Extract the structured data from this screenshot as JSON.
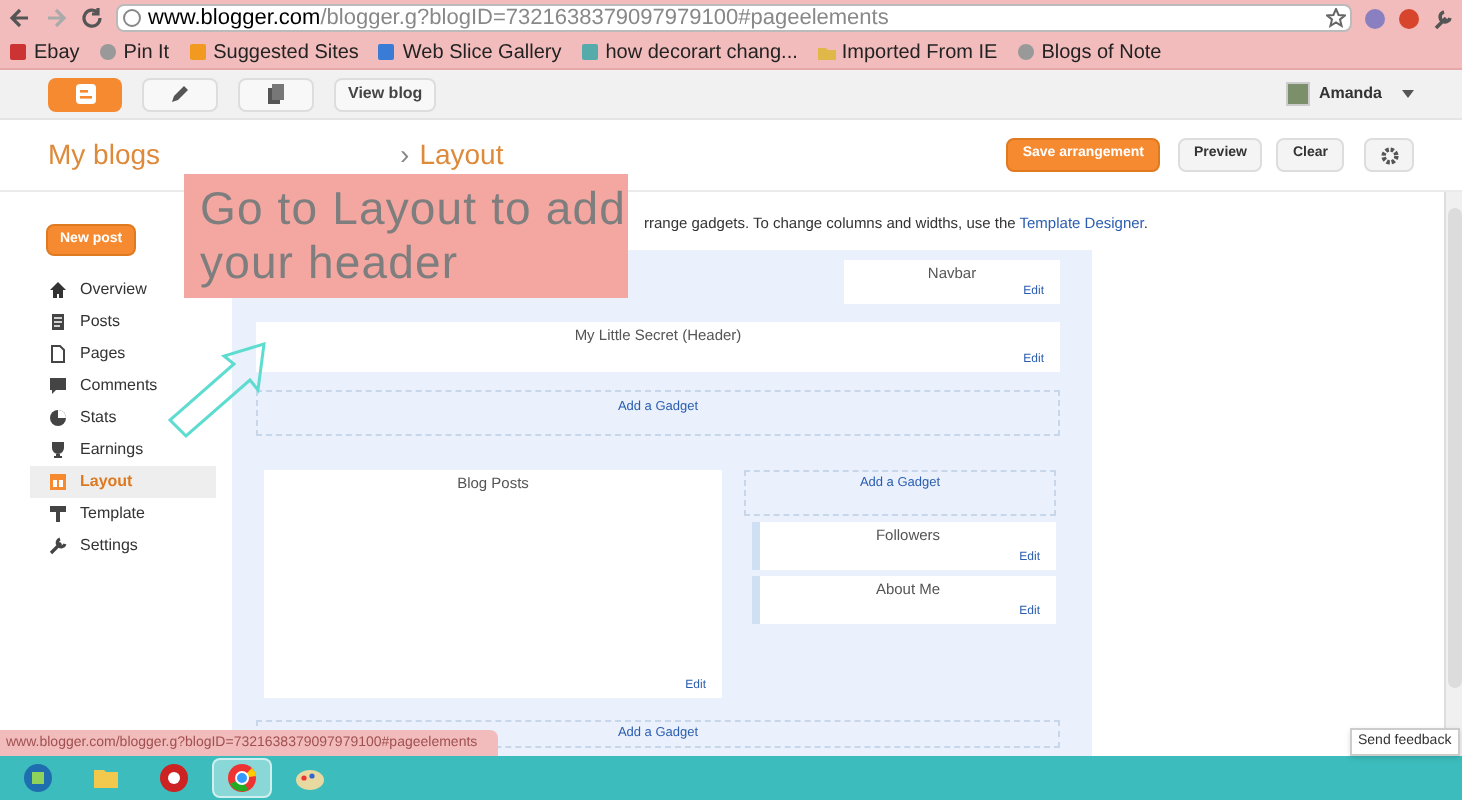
{
  "browser": {
    "url_host": "www.blogger.com",
    "url_path": "/blogger.g?blogID=7321638379097979100#pageelements",
    "bookmarks": [
      "Ebay",
      "Pin It",
      "Suggested Sites",
      "Web Slice Gallery",
      "how decorart chang...",
      "Imported From IE",
      "Blogs of Note"
    ]
  },
  "topbar": {
    "view_blog": "View blog",
    "user": "Amanda"
  },
  "header": {
    "title": "My blogs",
    "breadcrumb_sep": "›",
    "breadcrumb": "Layout",
    "actions": [
      "Save arrangement",
      "Preview",
      "Clear"
    ]
  },
  "sidebar": {
    "new_post": "New post",
    "items": [
      {
        "label": "Overview",
        "selected": false
      },
      {
        "label": "Posts",
        "selected": false
      },
      {
        "label": "Pages",
        "selected": false
      },
      {
        "label": "Comments",
        "selected": false
      },
      {
        "label": "Stats",
        "selected": false
      },
      {
        "label": "Earnings",
        "selected": false
      },
      {
        "label": "Layout",
        "selected": true
      },
      {
        "label": "Template",
        "selected": false
      },
      {
        "label": "Settings",
        "selected": false
      }
    ]
  },
  "description": {
    "text": "rrange gadgets. To change columns and widths, use the",
    "link": "Template Designer",
    "end": "."
  },
  "layout": {
    "navbar": {
      "title": "Navbar",
      "edit": "Edit"
    },
    "header": {
      "title": "My Little Secret (Header)",
      "edit": "Edit"
    },
    "add_gadget_top": "Add a Gadget",
    "main": {
      "title": "Blog Posts",
      "edit": "Edit"
    },
    "side_add_gadget": "Add a Gadget",
    "side_gadgets": [
      {
        "title": "Followers",
        "edit": "Edit"
      },
      {
        "title": "About Me",
        "edit": "Edit"
      }
    ],
    "add_gadget_bottom": "Add a Gadget"
  },
  "annotation": {
    "text": "Go to Layout to add your header"
  },
  "status_url": "www.blogger.com/blogger.g?blogID=7321638379097979100#pageelements",
  "send_feedback": "Send feedback",
  "taskbar": [
    {
      "selected": false
    },
    {
      "selected": false
    },
    {
      "selected": false
    },
    {
      "selected": true
    },
    {
      "selected": false
    }
  ]
}
